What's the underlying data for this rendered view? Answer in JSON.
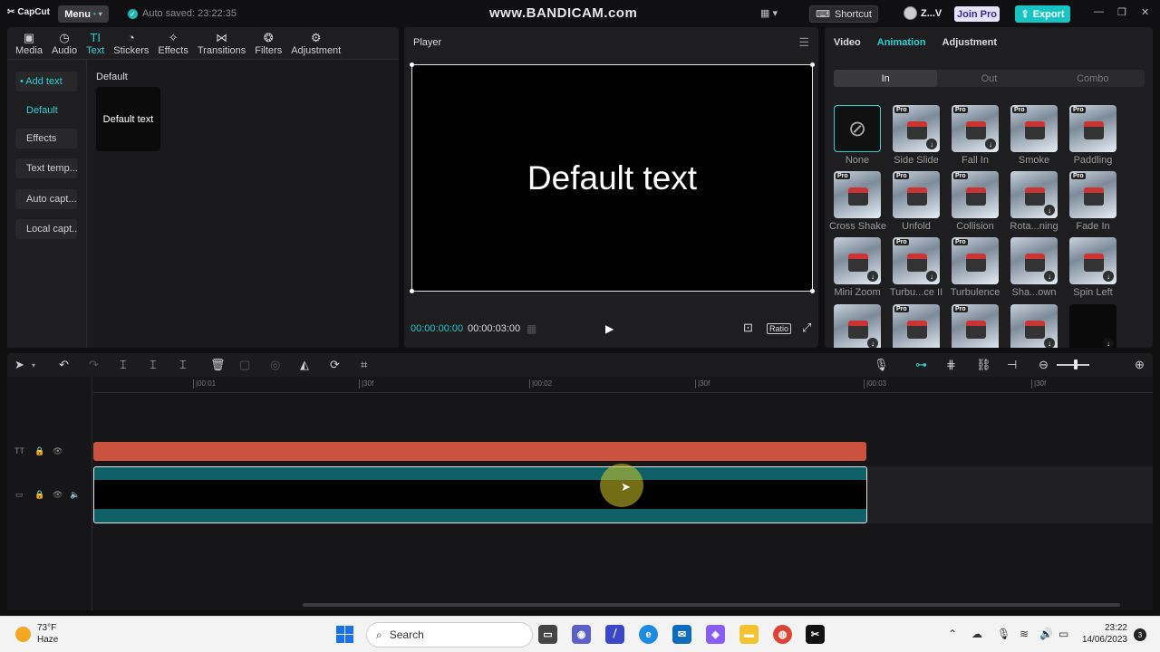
{
  "titlebar": {
    "app_name": "CapCut",
    "menu_label": "Menu",
    "autosave_text": "Auto saved: 23:22:35",
    "watermark": "www.BANDICAM.com",
    "shortcut_label": "Shortcut",
    "user_name": "Z...V",
    "join_pro_label": "Join Pro",
    "export_label": "Export"
  },
  "media_tabs": [
    {
      "label": "Media",
      "icon": "media-icon"
    },
    {
      "label": "Audio",
      "icon": "audio-icon"
    },
    {
      "label": "Text",
      "icon": "text-icon"
    },
    {
      "label": "Stickers",
      "icon": "stickers-icon"
    },
    {
      "label": "Effects",
      "icon": "effects-icon"
    },
    {
      "label": "Transitions",
      "icon": "transitions-icon"
    },
    {
      "label": "Filters",
      "icon": "filters-icon"
    },
    {
      "label": "Adjustment",
      "icon": "adjustment-icon"
    }
  ],
  "active_tab": "Text",
  "text_sidebar": {
    "items": [
      "• Add text",
      "Default",
      "Effects",
      "Text temp...",
      "Auto capt...",
      "Local capt..."
    ]
  },
  "text_library": {
    "section_label": "Default",
    "card_label": "Default text"
  },
  "player": {
    "title": "Player",
    "canvas_text": "Default text",
    "current_time": "00:00:00:00",
    "total_time": "00:00:03:00",
    "ratio_label": "Ratio"
  },
  "inspector": {
    "tabs": [
      "Video",
      "Animation",
      "Adjustment"
    ],
    "active_tab": "Animation",
    "segments": [
      "In",
      "Out",
      "Combo"
    ],
    "active_segment": "In",
    "animations": [
      {
        "label": "None"
      },
      {
        "label": "Side Slide"
      },
      {
        "label": "Fall In"
      },
      {
        "label": "Smoke"
      },
      {
        "label": "Paddling"
      },
      {
        "label": "Cross Shake"
      },
      {
        "label": "Unfold"
      },
      {
        "label": "Collision"
      },
      {
        "label": "Rota...ning"
      },
      {
        "label": "Fade In"
      },
      {
        "label": "Mini Zoom"
      },
      {
        "label": "Turbu...ce II"
      },
      {
        "label": "Turbulence"
      },
      {
        "label": "Sha...own"
      },
      {
        "label": "Spin Left"
      }
    ]
  },
  "timeline": {
    "ruler_labels": [
      "|00:01",
      "|30f",
      "|00:02",
      "|30f",
      "|00:03",
      "|30f"
    ]
  },
  "taskbar": {
    "temperature": "73°F",
    "condition": "Haze",
    "search_placeholder": "Search",
    "time": "23:22",
    "date": "14/06/2023",
    "notification_count": "3"
  },
  "colors": {
    "accent": "#16c4c4",
    "text_clip": "#c9533e",
    "video_clip": "#0f5f66"
  }
}
